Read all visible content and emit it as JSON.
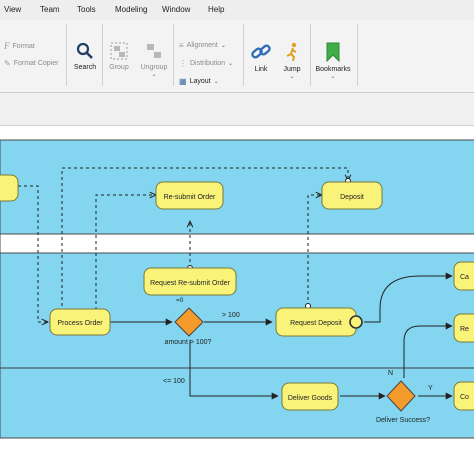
{
  "menu": [
    "View",
    "Team",
    "Tools",
    "Modeling",
    "Window",
    "Help"
  ],
  "ribbon": {
    "format": "Format",
    "format_copier": "Format Copier",
    "search": "Search",
    "group": "Group",
    "ungroup": "Ungroup",
    "alignment": "Alignment",
    "distribution": "Distribution",
    "layout": "Layout",
    "link": "Link",
    "jump": "Jump",
    "bookmarks": "Bookmarks"
  },
  "colors": {
    "lane": "#83d5f0",
    "task_fill": "#f9f37a",
    "gateway": "#f59b2c"
  },
  "diagram": {
    "tasks": {
      "resubmit_order": "Re-submit Order",
      "deposit": "Deposit",
      "request_resubmit": "Request Re-submit Order",
      "process_order": "Process Order",
      "request_deposit": "Request Deposit",
      "deliver_goods": "Deliver Goods",
      "ca_partial": "Ca",
      "re_partial": "Re",
      "co_partial": "Co"
    },
    "labels": {
      "eq0": "=0",
      "gt100": "> 100",
      "amount": "amount > 100?",
      "le100": "<= 100",
      "n": "N",
      "y": "Y",
      "deliver_success": "Deliver Success?"
    }
  }
}
